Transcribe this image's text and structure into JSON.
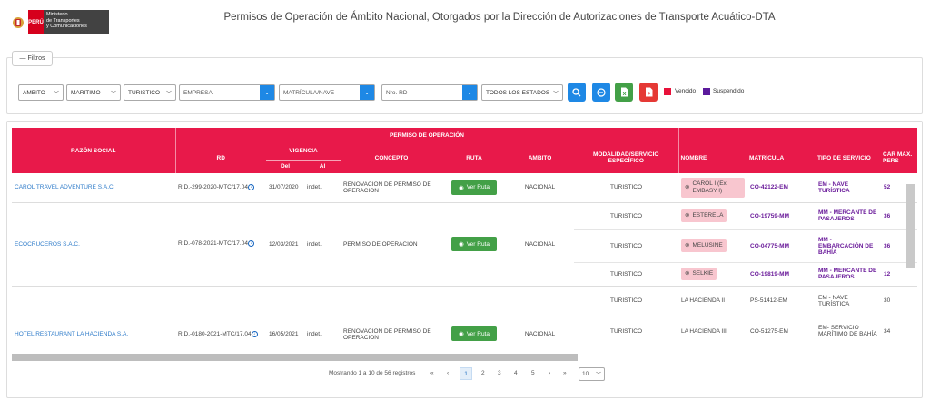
{
  "header": {
    "logo_peru": "PERÚ",
    "logo_ministry": "Ministerio\nde Transportes\ny Comunicaciones",
    "title": "Permisos de Operación de Ámbito Nacional, Otorgados por la Dirección de Autorizaciones de Transporte Acuático-DTA"
  },
  "filters": {
    "toggle_label": "Filtros",
    "ambito": "AMBITO",
    "tipo": "MARITIMO",
    "servicio": "TURISTICO",
    "empresa_placeholder": "EMPRESA",
    "matricula_placeholder": "MATRÍCULA/NAVE",
    "nro_rd_placeholder": "Nro. RD",
    "estado": "TODOS LOS ESTADOS",
    "legend": [
      {
        "label": "Vencido",
        "color": "#e8113a"
      },
      {
        "label": "Suspendido",
        "color": "#5b1a9c"
      }
    ]
  },
  "table": {
    "group_header": "PERMISO DE OPERACIÓN",
    "headers": {
      "razon_social": "RAZÓN SOCIAL",
      "rd": "RD",
      "vigencia": "VIGENCIA",
      "del": "Del",
      "al": "Al",
      "concepto": "CONCEPTO",
      "ruta": "RUTA",
      "ambito": "AMBITO",
      "modalidad": "MODALIDAD/SERVICIO ESPECÍFICO",
      "nombre": "NOMBRE",
      "matricula": "MATRÍCULA",
      "tipo_servicio": "TIPO DE SERVICIO",
      "car_max": "CAR MAX. PERS"
    },
    "ver_ruta_label": "Ver Ruta",
    "rows": [
      {
        "razon_social": "CAROL TRAVEL ADVENTURE S.A.C.",
        "rd": "R.D.-299-2020-MTC/17.04",
        "del": "31/07/2020",
        "al": "indet.",
        "concepto": "RENOVACION DE PERMISO DE OPERACION",
        "ambito": "NACIONAL",
        "vessels": [
          {
            "modalidad": "TURISTICO",
            "nombre": "CAROL I (Ex EMBASY I)",
            "matricula": "CO-42122-EM",
            "tipo": "EM - NAVE TURÍSTICA",
            "car": "52",
            "status": "vencido"
          }
        ]
      },
      {
        "razon_social": "ECOCRUCEROS S.A.C.",
        "rd": "R.D.-078-2021-MTC/17.04",
        "del": "12/03/2021",
        "al": "indet.",
        "concepto": "PERMISO DE OPERACION",
        "ambito": "NACIONAL",
        "vessels": [
          {
            "modalidad": "TURISTICO",
            "nombre": "ESTERELA",
            "matricula": "CO-19759-MM",
            "tipo": "MM - MERCANTE DE PASAJEROS",
            "car": "36",
            "status": "vencido"
          },
          {
            "modalidad": "TURISTICO",
            "nombre": "MELUSINE",
            "matricula": "CO-04775-MM",
            "tipo": "MM - EMBARCACIÓN DE BAHÍA",
            "car": "36",
            "status": "vencido"
          },
          {
            "modalidad": "TURISTICO",
            "nombre": "SELKIE",
            "matricula": "CO-19819-MM",
            "tipo": "MM - MERCANTE DE PASAJEROS",
            "car": "12",
            "status": "vencido"
          }
        ]
      },
      {
        "razon_social": "HOTEL RESTAURANT LA HACIENDA S.A.",
        "rd": "R.D.-0180-2021-MTC/17.04",
        "del": "16/05/2021",
        "al": "indet.",
        "concepto": "RENOVACION DE PERMISO DE OPERACION",
        "ambito": "NACIONAL",
        "vessels": [
          {
            "modalidad": "TURISTICO",
            "nombre": "LA HACIENDA II",
            "matricula": "PS-51412-EM",
            "tipo": "EM - NAVE TURÍSTICA",
            "car": "30",
            "status": "normal"
          },
          {
            "modalidad": "TURISTICO",
            "nombre": "LA HACIENDA III",
            "matricula": "CO-51275-EM",
            "tipo": "EM- SERVICIO MARÍTIMO DE BAHÍA",
            "car": "34",
            "status": "normal"
          }
        ]
      }
    ]
  },
  "pagination": {
    "info": "Mostrando 1 a 10 de 56 registros",
    "first": "«",
    "prev": "‹",
    "pages": [
      "1",
      "2",
      "3",
      "4",
      "5"
    ],
    "next": "›",
    "last": "»",
    "page_size": "10"
  }
}
